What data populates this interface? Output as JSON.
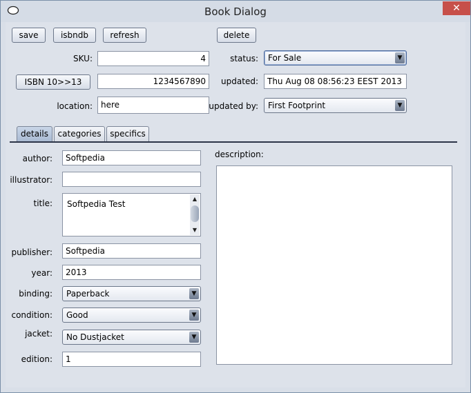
{
  "window": {
    "title": "Book Dialog",
    "close_glyph": "✕"
  },
  "toolbar": {
    "save": "save",
    "isbndb": "isbndb",
    "refresh": "refresh",
    "delete": "delete"
  },
  "form": {
    "sku_label": "SKU:",
    "sku_value": "4",
    "isbn_button": "ISBN 10>>13",
    "isbn_value": "1234567890",
    "location_label": "location:",
    "location_value": "here",
    "status_label": "status:",
    "status_value": "For Sale",
    "updated_label": "updated:",
    "updated_value": "Thu Aug 08 08:56:23 EEST 2013",
    "updated_by_label": "updated by:",
    "updated_by_value": "First Footprint"
  },
  "tabs": [
    {
      "label": "details"
    },
    {
      "label": "categories"
    },
    {
      "label": "specifics"
    }
  ],
  "details": {
    "author_label": "author:",
    "author_value": "Softpedia",
    "illustrator_label": "illustrator:",
    "illustrator_value": "",
    "title_label": "title:",
    "title_value": "Softpedia Test",
    "publisher_label": "publisher:",
    "publisher_value": "Softpedia",
    "year_label": "year:",
    "year_value": "2013",
    "binding_label": "binding:",
    "binding_value": "Paperback",
    "condition_label": "condition:",
    "condition_value": "Good",
    "jacket_label": "jacket:",
    "jacket_value": "No Dustjacket",
    "edition_label": "edition:",
    "edition_value": "1",
    "description_label": "description:",
    "description_value": ""
  },
  "icons": {
    "dropdown": "chevron-down-icon",
    "scroll_up": "arrow-up-icon",
    "scroll_down": "arrow-down-icon",
    "app": "app-window-icon"
  }
}
